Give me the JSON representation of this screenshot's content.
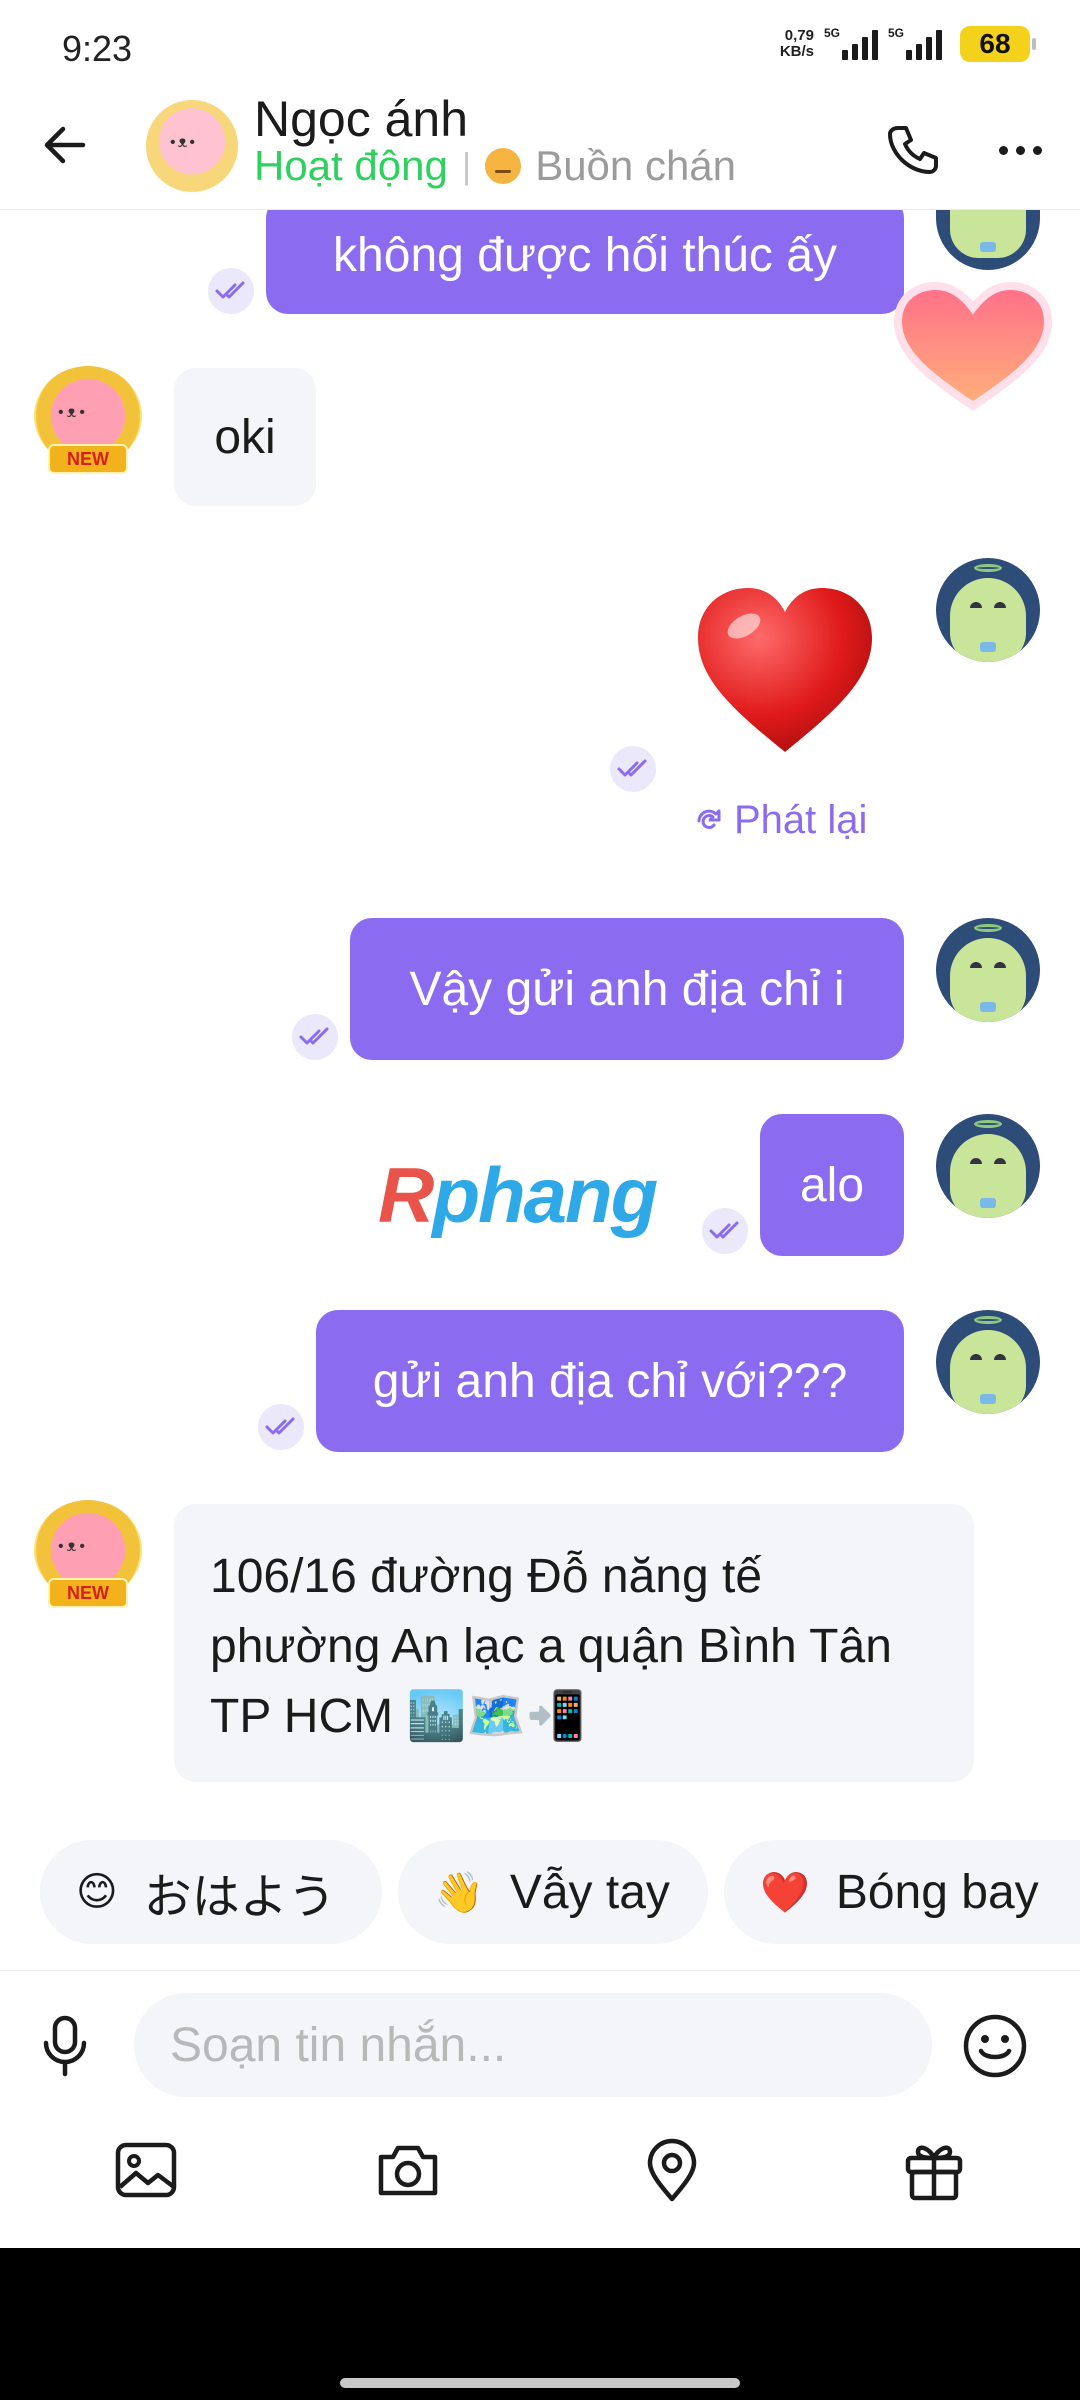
{
  "status_bar": {
    "time": "9:23",
    "net_speed_value": "0,79",
    "net_speed_unit": "KB/s",
    "network_1": "5G",
    "network_2": "5G",
    "battery": "68"
  },
  "header": {
    "contact_name": "Ngọc ánh",
    "presence": "Hoạt động",
    "separator": "|",
    "mood": "Buồn chán"
  },
  "messages": [
    {
      "direction": "out",
      "text": "không được hối thúc ấy"
    },
    {
      "direction": "in",
      "text": "oki"
    },
    {
      "direction": "out",
      "type": "sticker",
      "sticker": "heart-sticker",
      "replay_label": "Phát lại"
    },
    {
      "direction": "out",
      "text": "Vậy gửi anh địa chỉ i"
    },
    {
      "direction": "out",
      "text": "alo"
    },
    {
      "direction": "out",
      "text": "gửi anh địa chỉ với???"
    },
    {
      "direction": "in",
      "text": "106/16 đường Đỗ năng tế phường An lạc a quận Bình Tân TP HCM 🏙️🗺️📲"
    }
  ],
  "avatar_badge": "NEW",
  "watermark": {
    "first": "R",
    "rest": "phang"
  },
  "quick_replies": [
    {
      "emoji": "😊",
      "label": "おはよう"
    },
    {
      "emoji": "👋",
      "label": "Vẫy tay"
    },
    {
      "emoji": "❤️",
      "label": "Bóng bay"
    }
  ],
  "composer": {
    "placeholder": "Soạn tin nhắn..."
  },
  "colors": {
    "accent": "#8b6cf0",
    "presence": "#2fd15e",
    "incoming_bubble": "#f4f5f8"
  }
}
